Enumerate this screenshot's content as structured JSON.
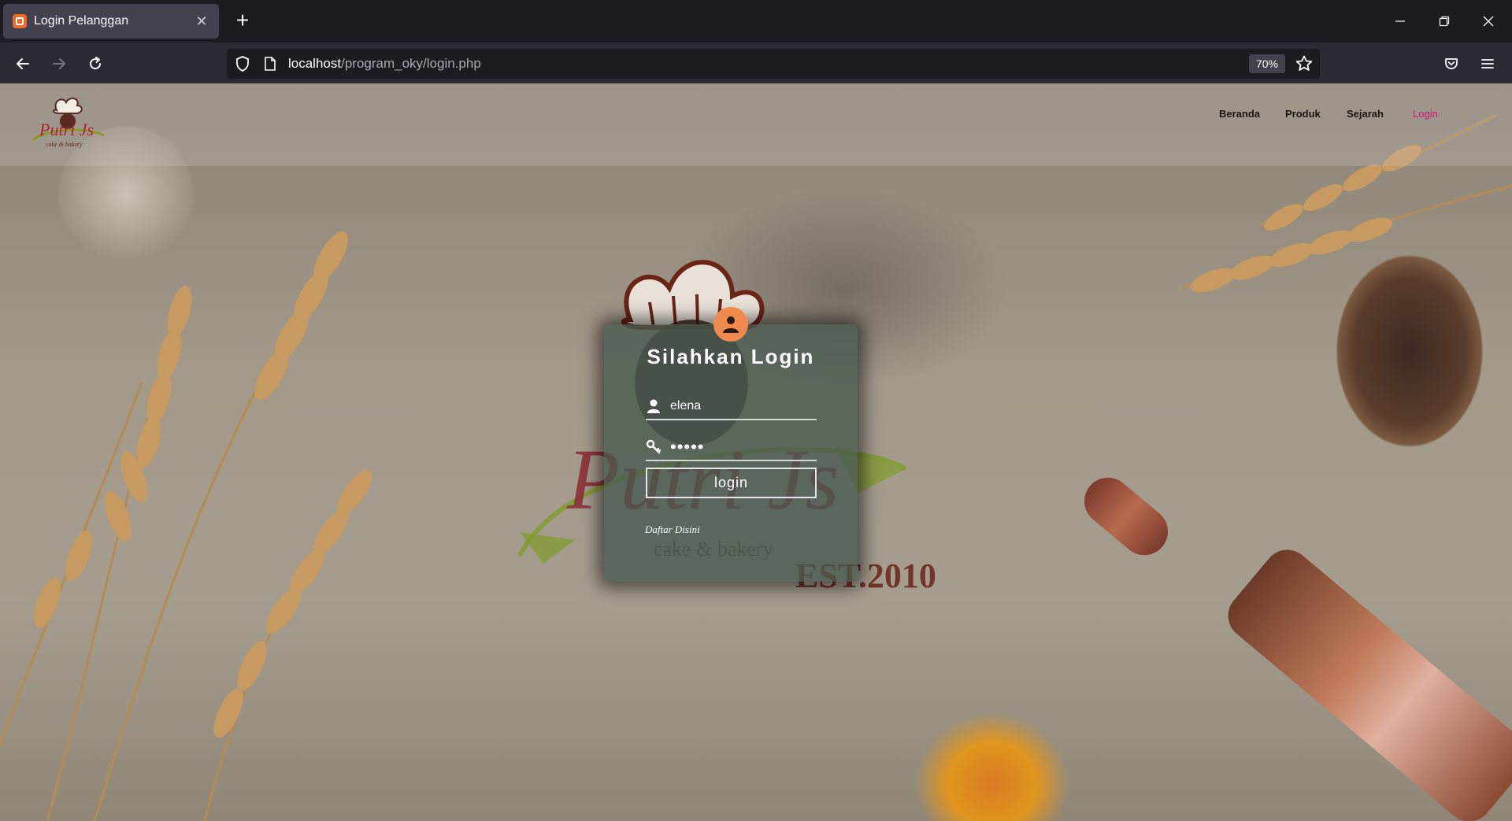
{
  "browser": {
    "tab_title": "Login Pelanggan",
    "url_host": "localhost",
    "url_path": "/program_oky/login.php",
    "zoom": "70%"
  },
  "site": {
    "logo_text": "Putri Js",
    "logo_tagline": "cake & bakery",
    "logo_est": "EST.2010",
    "nav": [
      "Beranda",
      "Produk",
      "Sejarah",
      "Login"
    ],
    "active_nav": "Login",
    "active_color": "#d4147a"
  },
  "login": {
    "title": "Silahkan Login",
    "username_value": "elena",
    "password_value": "•••••",
    "button_label": "login",
    "register_link": "Daftar Disini",
    "accent_color": "#f08a4c"
  }
}
